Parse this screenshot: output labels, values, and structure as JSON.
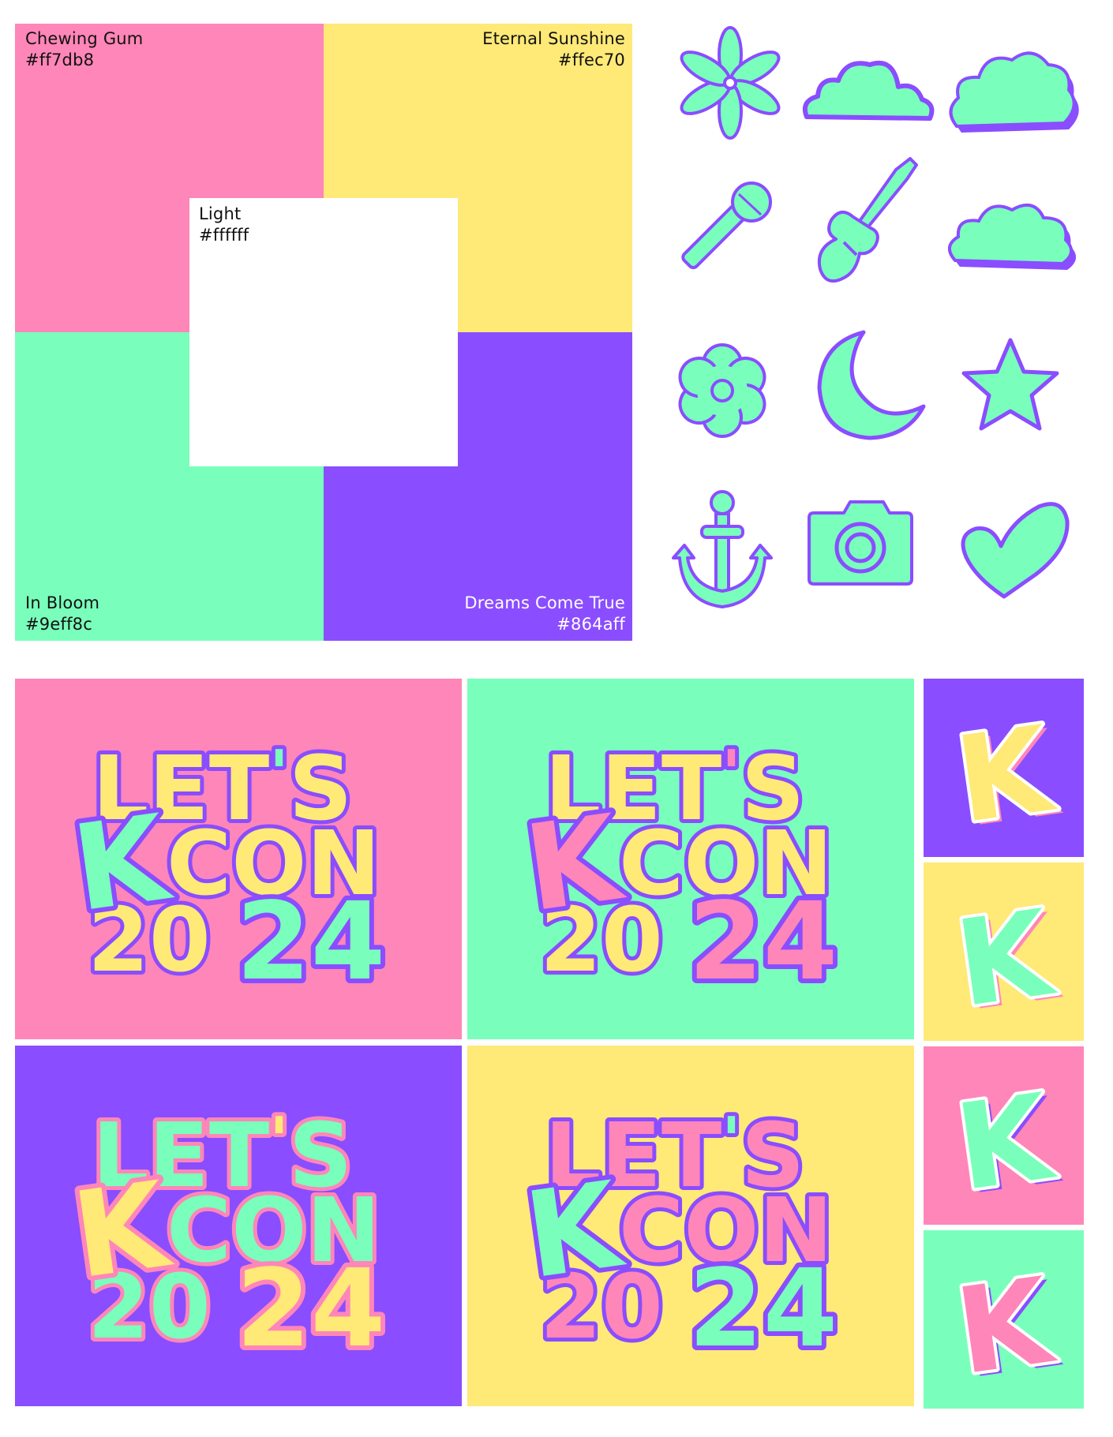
{
  "palette": {
    "chewing_gum": {
      "name": "Chewing Gum",
      "hex": "#ff7db8"
    },
    "eternal_sunshine": {
      "name": "Eternal Sunshine",
      "hex": "#ffec70"
    },
    "light": {
      "name": "Light",
      "hex": "#ffffff"
    },
    "in_bloom": {
      "name": "In Bloom",
      "hex": "#9eff8c"
    },
    "dreams_come_true": {
      "name": "Dreams Come True",
      "hex": "#864aff"
    }
  },
  "display_colors": {
    "pink": "#ff86b8",
    "yellow": "#ffe977",
    "mint": "#79ffbb",
    "purple": "#8a4dff",
    "white": "#ffffff"
  },
  "icons": [
    "flower-asterisk-icon",
    "cloud-icon",
    "puffy-cloud-icon",
    "microphone-icon",
    "guitar-icon",
    "puffy-cloud-icon",
    "daisy-icon",
    "crescent-moon-icon",
    "star-icon",
    "anchor-icon",
    "camera-icon",
    "heart-icon"
  ],
  "logo": {
    "line1": "LET",
    "apostrophe": "'",
    "line1_end": "S",
    "line2_k": "K",
    "line2": "CON",
    "line3": "20",
    "line3_end": "24"
  },
  "logo_cards": [
    {
      "bg": "#ff86b8",
      "text": "#ffe977",
      "accent": "#79ffbb",
      "outline": "#8a4dff"
    },
    {
      "bg": "#79ffbb",
      "text": "#ffe977",
      "accent": "#ff86b8",
      "outline": "#8a4dff"
    },
    {
      "bg": "#8a4dff",
      "text": "#79ffbb",
      "accent": "#ffe977",
      "outline": "#ff86b8"
    },
    {
      "bg": "#ffe977",
      "text": "#ff86b8",
      "accent": "#79ffbb",
      "outline": "#8a4dff"
    }
  ],
  "k_tiles": [
    {
      "bg": "#8a4dff",
      "fill": "#ffe977",
      "shadow": "#ff86b8"
    },
    {
      "bg": "#ffe977",
      "fill": "#79ffbb",
      "shadow": "#ff86b8"
    },
    {
      "bg": "#ff86b8",
      "fill": "#79ffbb",
      "shadow": "#8a4dff"
    },
    {
      "bg": "#79ffbb",
      "fill": "#ff86b8",
      "shadow": "#8a4dff"
    }
  ]
}
